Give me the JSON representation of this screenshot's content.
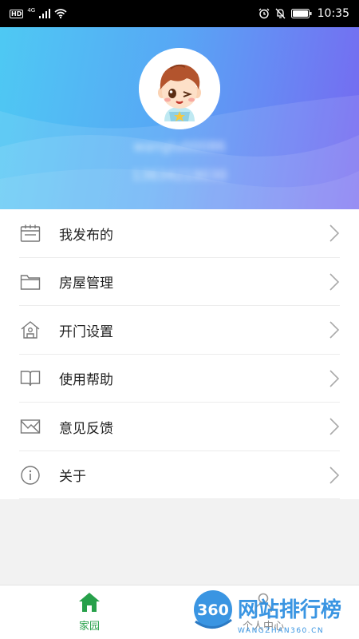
{
  "status_bar": {
    "hd": "HD",
    "network": "4G",
    "time": "10:35"
  },
  "profile": {
    "username": "wanglu00086",
    "phone": "13634219030"
  },
  "menu": {
    "items": [
      {
        "label": "我发布的",
        "icon": "calendar-icon"
      },
      {
        "label": "房屋管理",
        "icon": "folder-icon"
      },
      {
        "label": "开门设置",
        "icon": "house-icon"
      },
      {
        "label": "使用帮助",
        "icon": "book-icon"
      },
      {
        "label": "意见反馈",
        "icon": "envelope-icon"
      },
      {
        "label": "关于",
        "icon": "info-icon"
      }
    ]
  },
  "bottom_nav": {
    "home_label": "家园",
    "me_label": "个人中心"
  },
  "watermark": {
    "number": "360",
    "title": "网站排行榜",
    "url": "WANGZHAN360.CN"
  },
  "colors": {
    "accent_green": "#27a04a",
    "header_start": "#4ec9f3",
    "header_end": "#7668f0"
  }
}
